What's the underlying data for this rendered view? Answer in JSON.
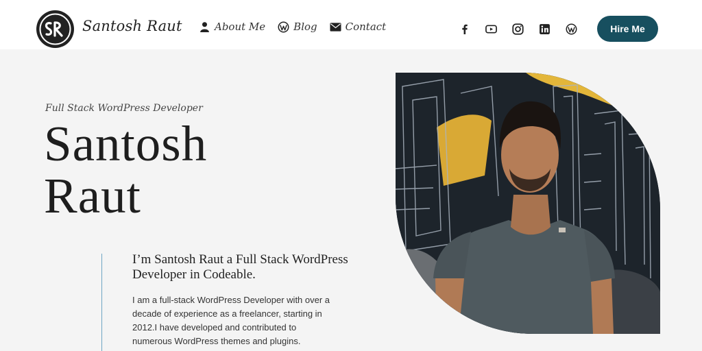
{
  "header": {
    "logo_alt": "SR logo",
    "site_name": "Santosh Raut",
    "nav": [
      {
        "label": "About Me",
        "icon": "user-icon"
      },
      {
        "label": "Blog",
        "icon": "wordpress-icon"
      },
      {
        "label": "Contact",
        "icon": "mail-icon"
      }
    ],
    "social": [
      {
        "icon": "facebook-icon"
      },
      {
        "icon": "youtube-icon"
      },
      {
        "icon": "instagram-icon"
      },
      {
        "icon": "linkedin-icon"
      },
      {
        "icon": "wordpress-icon"
      }
    ],
    "hire_label": "Hire Me"
  },
  "hero": {
    "tagline": "Full Stack WordPress Developer",
    "name_line1": "Santosh",
    "name_line2": "Raut",
    "intro_heading": "I’m Santosh Raut a Full Stack WordPress Developer in Codeable.",
    "intro_body": "I am a full-stack WordPress Developer with over a decade of experience as a freelancer, starting in 2012.I have developed and contributed to numerous WordPress themes and plugins.",
    "photo_alt": "Portrait of Santosh Raut"
  },
  "colors": {
    "accent": "#174f5f",
    "background": "#f4f4f4",
    "divider": "#6fa6c4"
  }
}
